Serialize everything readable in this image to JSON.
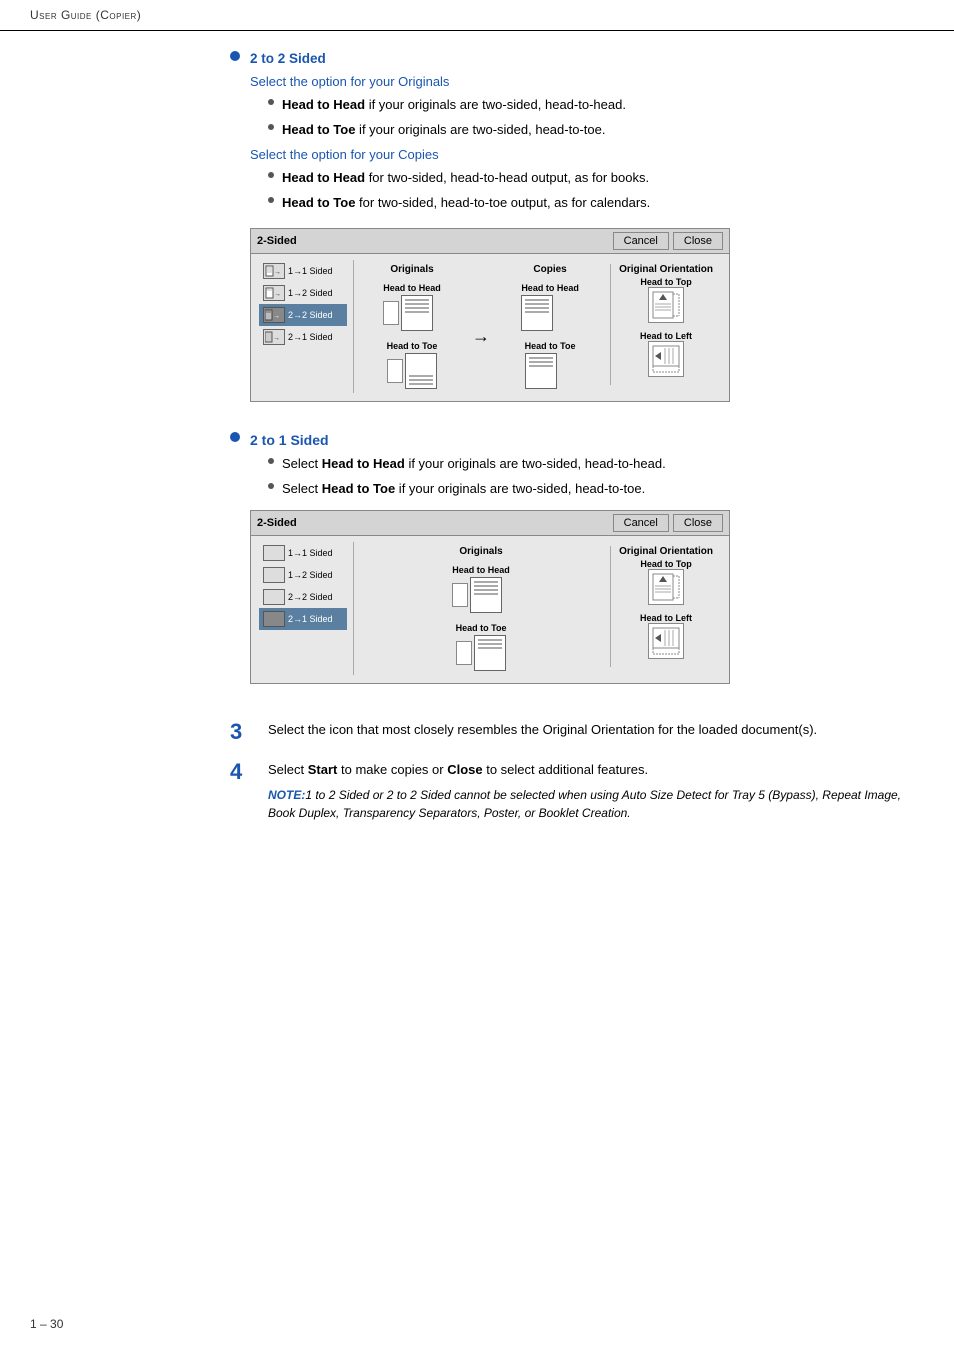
{
  "header": {
    "title": "User Guide (Copier)"
  },
  "footer": {
    "page_number": "1 – 30"
  },
  "section_2to2sided": {
    "title": "2 to 2 Sided",
    "originals_label": "Select the option for your Originals",
    "originals_bullets": [
      {
        "bold": "Head to Head",
        "rest": " if your originals are two-sided, head-to-head."
      },
      {
        "bold": "Head to Toe",
        "rest": " if your originals are two-sided, head-to-toe."
      }
    ],
    "copies_label": "Select the option for your Copies",
    "copies_bullets": [
      {
        "bold": "Head to Head",
        "rest": " for two-sided, head-to-head output, as for books."
      },
      {
        "bold": "Head to Toe",
        "rest": " for two-sided, head-to-toe output, as for calendars."
      }
    ]
  },
  "section_2to1sided": {
    "title": "2 to 1 Sided",
    "bullets": [
      {
        "bold": "Head to Head",
        "rest": " if your originals are two-sided, head-to-head."
      },
      {
        "bold": "Head to Toe",
        "rest": " if your originals are two-sided, head-to-toe."
      }
    ],
    "pre_bold": "Select ",
    "post1": " if your originals are two-sided, head-to-head.",
    "post2": " if your originals are two-sided, head-to-toe."
  },
  "dialog1": {
    "title": "2-Sided",
    "cancel_label": "Cancel",
    "close_label": "Close",
    "sidebar_options": [
      {
        "icon": "1to1",
        "label": "1→1 Sided",
        "selected": false
      },
      {
        "icon": "1to2",
        "label": "1→2 Sided",
        "selected": false
      },
      {
        "icon": "2to2",
        "label": "2→2 Sided",
        "selected": true
      },
      {
        "icon": "2to1",
        "label": "2→1 Sided",
        "selected": false
      }
    ],
    "originals_col_label": "Originals",
    "copies_col_label": "Copies",
    "orientation_col_label": "Original Orientation",
    "originals_options": [
      {
        "label": "Head to Head"
      },
      {
        "label": "Head to Toe"
      }
    ],
    "copies_options": [
      {
        "label": "Head to Head"
      },
      {
        "label": "Head to Toe"
      }
    ],
    "orientation_options": [
      {
        "label": "Head to Top"
      },
      {
        "label": "Head to Left"
      }
    ]
  },
  "dialog2": {
    "title": "2-Sided",
    "cancel_label": "Cancel",
    "close_label": "Close",
    "sidebar_options": [
      {
        "icon": "1to1",
        "label": "1→1 Sided",
        "selected": false
      },
      {
        "icon": "1to2",
        "label": "1→2 Sided",
        "selected": false
      },
      {
        "icon": "2to2",
        "label": "2→2 Sided",
        "selected": false
      },
      {
        "icon": "2to1",
        "label": "2→1 Sided",
        "selected": true
      }
    ],
    "originals_col_label": "Originals",
    "orientation_col_label": "Original Orientation",
    "originals_options": [
      {
        "label": "Head to Head"
      },
      {
        "label": "Head to Toe"
      }
    ],
    "orientation_options": [
      {
        "label": "Head to Top"
      },
      {
        "label": "Head to Left"
      }
    ]
  },
  "steps": [
    {
      "number": "3",
      "text": "Select the icon that most closely resembles the Original Orientation for the loaded document(s)."
    },
    {
      "number": "4",
      "text_start": "Select ",
      "bold1": "Start",
      "text_mid": " to make copies or ",
      "bold2": "Close",
      "text_end": " to select additional features.",
      "note_label": "NOTE:",
      "note_text": "1 to 2 Sided or 2 to 2 Sided cannot be selected when using Auto Size Detect for Tray 5 (Bypass), Repeat Image, Book Duplex, Transparency Separators, Poster, or Booklet Creation."
    }
  ]
}
